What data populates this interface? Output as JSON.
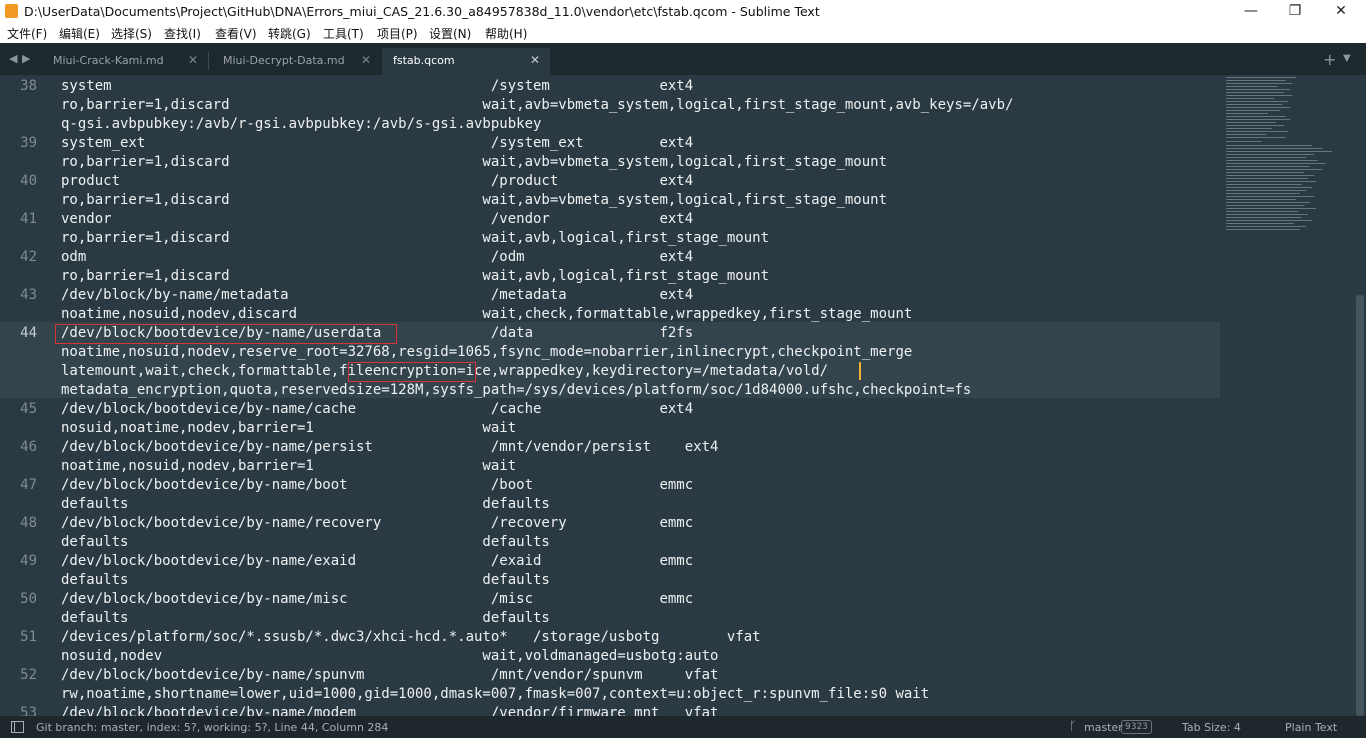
{
  "window": {
    "title": "D:\\UserData\\Documents\\Project\\GitHub\\DNA\\Errors_miui_CAS_21.6.30_a84957838d_11.0\\vendor\\etc\\fstab.qcom - Sublime Text",
    "minimize": "—",
    "maximize": "❐",
    "close": "✕"
  },
  "menu": [
    "文件(F)",
    "编辑(E)",
    "选择(S)",
    "查找(I)",
    "查看(V)",
    "转跳(G)",
    "工具(T)",
    "项目(P)",
    "设置(N)",
    "帮助(H)"
  ],
  "tabs": {
    "nav_prev": "◀",
    "nav_next": "▶",
    "items": [
      {
        "label": "Miui-Crack-Kami.md",
        "close": "✕"
      },
      {
        "label": "Miui-Decrypt-Data.md",
        "close": "✕"
      },
      {
        "label": "fstab.qcom",
        "close": "✕"
      }
    ],
    "add": "+",
    "overflow": "▼"
  },
  "editor": {
    "line_numbers": [
      "38",
      "39",
      "40",
      "41",
      "42",
      "43",
      "44",
      "45",
      "46",
      "47",
      "48",
      "49",
      "50",
      "51",
      "52",
      "53"
    ],
    "lines": [
      "system                                             /system             ext4",
      "ro,barrier=1,discard                              wait,avb=vbmeta_system,logical,first_stage_mount,avb_keys=/avb/",
      "q-gsi.avbpubkey:/avb/r-gsi.avbpubkey:/avb/s-gsi.avbpubkey",
      "system_ext                                         /system_ext         ext4",
      "ro,barrier=1,discard                              wait,avb=vbmeta_system,logical,first_stage_mount",
      "product                                            /product            ext4",
      "ro,barrier=1,discard                              wait,avb=vbmeta_system,logical,first_stage_mount",
      "vendor                                             /vendor             ext4",
      "ro,barrier=1,discard                              wait,avb,logical,first_stage_mount",
      "odm                                                /odm                ext4",
      "ro,barrier=1,discard                              wait,avb,logical,first_stage_mount",
      "/dev/block/by-name/metadata                        /metadata           ext4",
      "noatime,nosuid,nodev,discard                      wait,check,formattable,wrappedkey,first_stage_mount",
      "/dev/block/bootdevice/by-name/userdata             /data               f2fs",
      "noatime,nosuid,nodev,reserve_root=32768,resgid=1065,fsync_mode=nobarrier,inlinecrypt,checkpoint_merge",
      "latemount,wait,check,formattable,fileencryption=ice,wrappedkey,keydirectory=/metadata/vold/",
      "metadata_encryption,quota,reservedsize=128M,sysfs_path=/sys/devices/platform/soc/1d84000.ufshc,checkpoint=fs",
      "/dev/block/bootdevice/by-name/cache                /cache              ext4",
      "nosuid,noatime,nodev,barrier=1                    wait",
      "/dev/block/bootdevice/by-name/persist              /mnt/vendor/persist    ext4",
      "noatime,nosuid,nodev,barrier=1                    wait",
      "/dev/block/bootdevice/by-name/boot                 /boot               emmc",
      "defaults                                          defaults",
      "/dev/block/bootdevice/by-name/recovery             /recovery           emmc",
      "defaults                                          defaults",
      "/dev/block/bootdevice/by-name/exaid                /exaid              emmc",
      "defaults                                          defaults",
      "/dev/block/bootdevice/by-name/misc                 /misc               emmc",
      "defaults                                          defaults",
      "/devices/platform/soc/*.ssusb/*.dwc3/xhci-hcd.*.auto*   /storage/usbotg        vfat",
      "nosuid,nodev                                      wait,voldmanaged=usbotg:auto",
      "/dev/block/bootdevice/by-name/spunvm               /mnt/vendor/spunvm     vfat",
      "rw,noatime,shortname=lower,uid=1000,gid=1000,dmask=007,fmask=007,context=u:object_r:spunvm_file:s0 wait",
      "/dev/block/bootdevice/by-name/modem                /vendor/firmware_mnt   vfat"
    ]
  },
  "status": {
    "git": "Git branch: master, index: 5?, working: 5?, Line 44, Column 284",
    "branch_icon": "ᚴ",
    "branch": "master",
    "badge": "9323",
    "tab_size": "Tab Size: 4",
    "syntax": "Plain Text"
  },
  "colors": {
    "editor_bg": "#2b3a42",
    "highlight_box": "#d6333d",
    "cursor": "#f2b533"
  }
}
